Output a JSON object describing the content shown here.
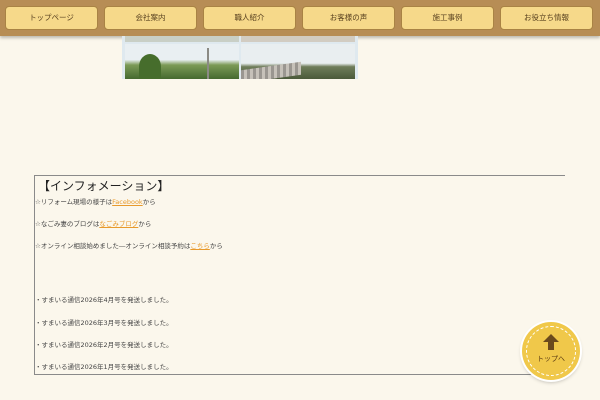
{
  "nav": {
    "items": [
      {
        "label": "トップページ"
      },
      {
        "label": "会社案内"
      },
      {
        "label": "職人紹介"
      },
      {
        "label": "お客様の声"
      },
      {
        "label": "施工事例"
      },
      {
        "label": "お役立ち情報"
      }
    ]
  },
  "info": {
    "title": "【インフォメーション】",
    "line1": {
      "prefix": "☆リフォーム現場の様子は",
      "link": "Facebook",
      "suffix": "から"
    },
    "line2": {
      "prefix": "☆なごみ妻のブログは",
      "link": "なごみブログ",
      "suffix": "から"
    },
    "line3": {
      "prefix": "☆オンライン相談始めました―オンライン相談予約は",
      "link": "こちら",
      "suffix": "から"
    },
    "news": [
      "・すまいる通信2026年4月号を発送しました。",
      "・すまいる通信2026年3月号を発送しました。",
      "・すまいる通信2026年2月号を発送しました。",
      "・すまいる通信2026年1月号を発送しました。"
    ]
  },
  "back_to_top": {
    "label": "トップへ",
    "icon": "arrow-up-icon"
  },
  "colors": {
    "nav_bar": "#b78d55",
    "nav_button": "#f6d98a",
    "link": "#e89a2c",
    "top_button": "#f0c84a"
  }
}
